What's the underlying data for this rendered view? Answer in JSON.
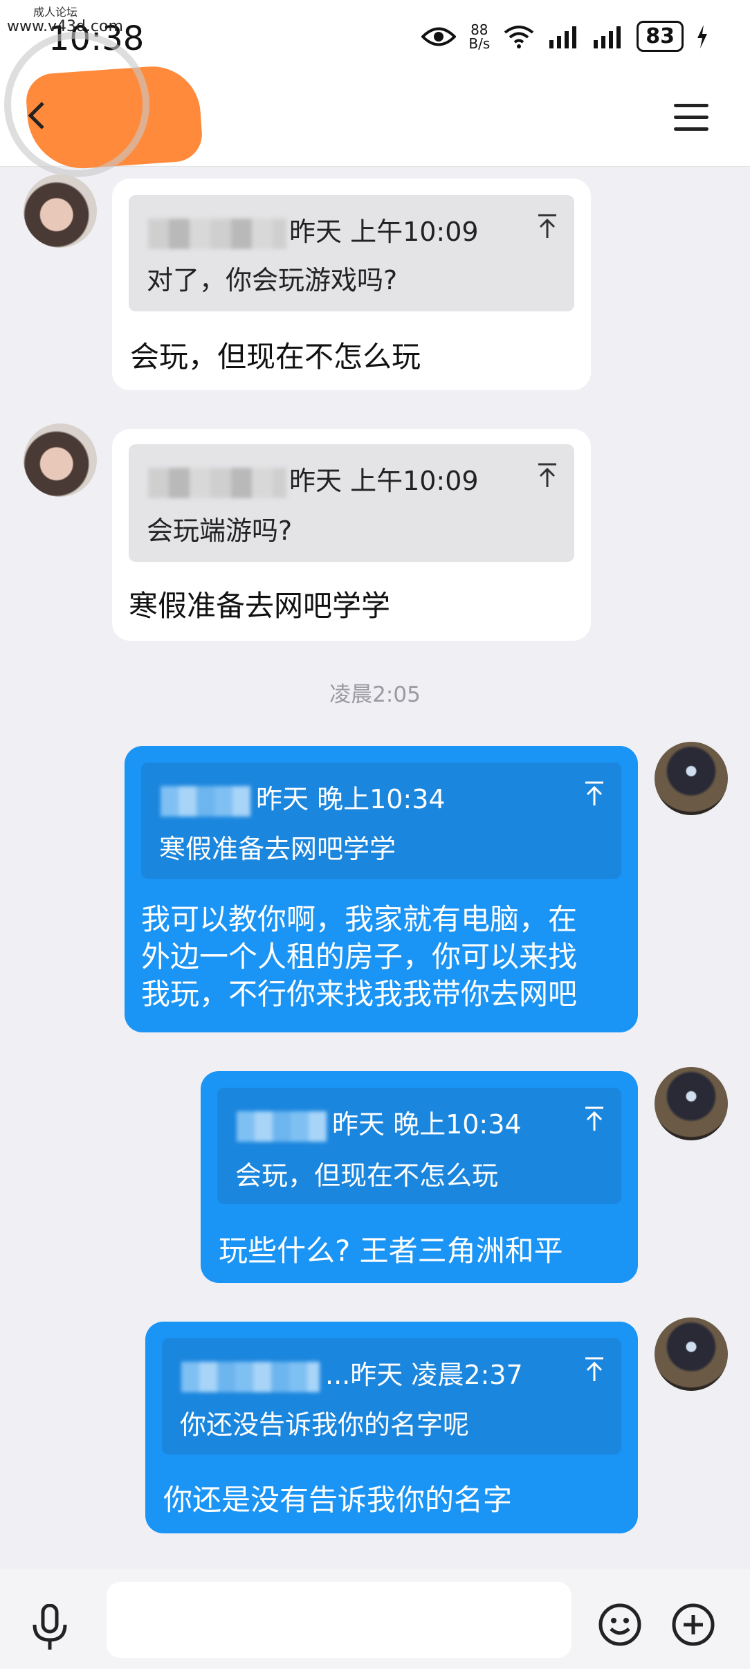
{
  "status_bar": {
    "time": "10:38",
    "net_speed_value": "88",
    "net_speed_unit": "B/s",
    "battery": "83"
  },
  "watermark": {
    "top_text": "成人论坛",
    "url": "www.v43d.com"
  },
  "messages": [
    {
      "side": "in",
      "quote_time": "昨天 上午10:09",
      "quote_text": "对了，你会玩游戏吗?",
      "text": "会玩，但现在不怎么玩"
    },
    {
      "side": "in",
      "quote_time": "昨天 上午10:09",
      "quote_text": "会玩端游吗?",
      "text": "寒假准备去网吧学学"
    },
    {
      "side": "out",
      "quote_time": "昨天 晚上10:34",
      "quote_text": "寒假准备去网吧学学",
      "lines": [
        "我可以教你啊，我家就有电脑，在",
        "外边一个人租的房子，你可以来找",
        "我玩，不行你来找我我带你去网吧"
      ]
    },
    {
      "side": "out",
      "quote_time": "昨天 晚上10:34",
      "quote_text": "会玩，但现在不怎么玩",
      "text": "玩些什么? 王者三角洲和平"
    },
    {
      "side": "out",
      "quote_time": "...昨天 凌晨2:37",
      "quote_text": "你还没告诉我你的名字呢",
      "text": "你还是没有告诉我你的名字"
    }
  ],
  "time_separator": "凌晨2:05",
  "input": {
    "placeholder": ""
  },
  "icons": {
    "back": "back-icon",
    "menu": "menu-icon",
    "pin": "pin-top-icon",
    "mic": "mic-icon",
    "emoji": "emoji-icon",
    "plus": "plus-icon"
  },
  "colors": {
    "outgoing_bubble": "#1a94f5",
    "incoming_bubble": "#ffffff",
    "background": "#efeff4"
  }
}
